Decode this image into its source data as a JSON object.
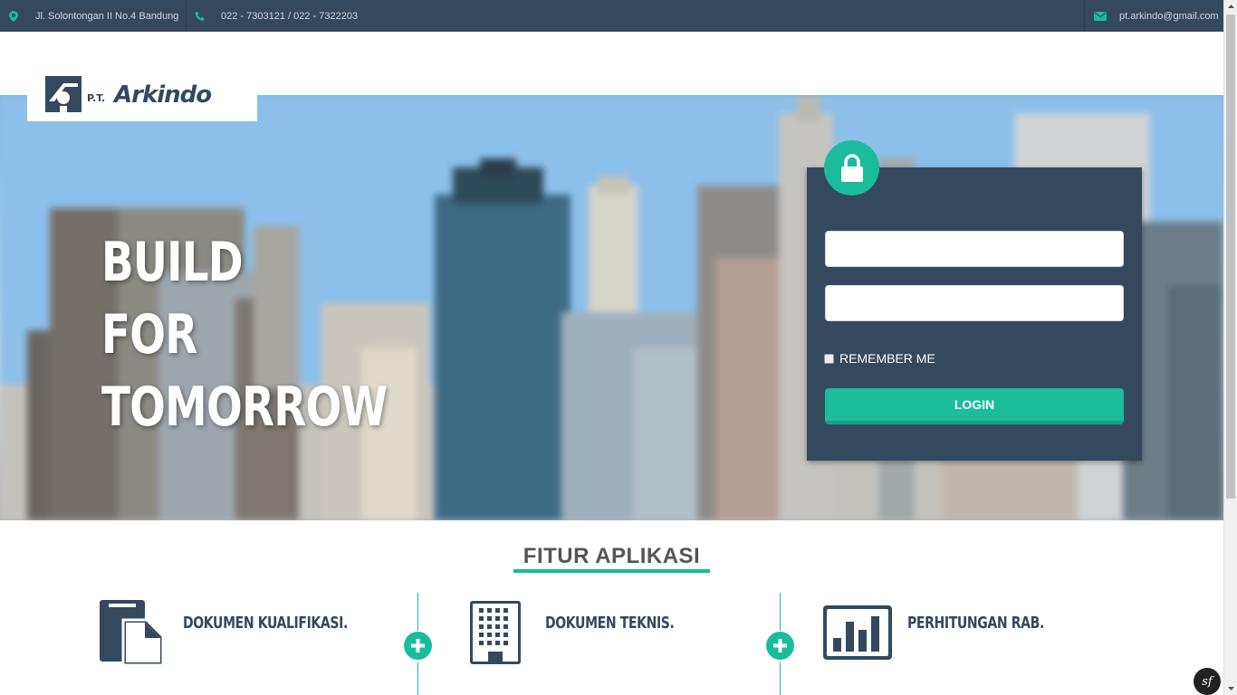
{
  "topbar": {
    "address": "Jl. Solontongan II No.4 Bandung",
    "phone": "022 - 7303121 / 022 - 7322203",
    "email": "pt.arkindo@gmail.com",
    "icons": [
      "map-marker-icon",
      "phone-icon",
      "envelope-icon"
    ]
  },
  "logo": {
    "alt": "P.T. Arkindo"
  },
  "hero": {
    "lines": [
      "BUILD",
      "FOR",
      "TOMORROW"
    ]
  },
  "login": {
    "username_value": "",
    "password_value": "",
    "remember_label": "REMEMBER ME",
    "remember_checked": false,
    "button_label": "LOGIN"
  },
  "features": {
    "title": "FITUR APLIKASI",
    "items": [
      {
        "label": "DOKUMEN KUALIFIKASI.",
        "icon": "document-icon"
      },
      {
        "label": "DOKUMEN TEKNIS.",
        "icon": "building-icon"
      },
      {
        "label": "PERHITUNGAN RAB.",
        "icon": "bar-chart-icon"
      }
    ]
  },
  "debug_badge": "sf",
  "colors": {
    "accent": "#1abc9c",
    "dark": "#34495e"
  }
}
